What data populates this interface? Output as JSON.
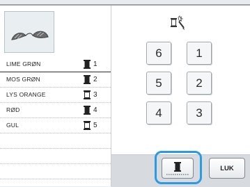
{
  "threads": [
    {
      "name": "LIME GRØN",
      "number": "1",
      "spool": "filled"
    },
    {
      "name": "MOS GRØN",
      "number": "2",
      "spool": "filled"
    },
    {
      "name": "LYS ORANGE",
      "number": "3",
      "spool": "outline"
    },
    {
      "name": "RØD",
      "number": "4",
      "spool": "filled"
    },
    {
      "name": "GUL",
      "number": "5",
      "spool": "outline"
    }
  ],
  "keypad": {
    "b6": "6",
    "b1": "1",
    "b5": "5",
    "b2": "2",
    "b4": "4",
    "b3": "3"
  },
  "icons": {
    "preview": "embroidery-preview",
    "clear": "spool-clear-icon",
    "spool": "thread-spool-icon"
  },
  "buttons": {
    "close_label": "LUK"
  },
  "colors": {
    "highlight": "#2a9be3"
  }
}
